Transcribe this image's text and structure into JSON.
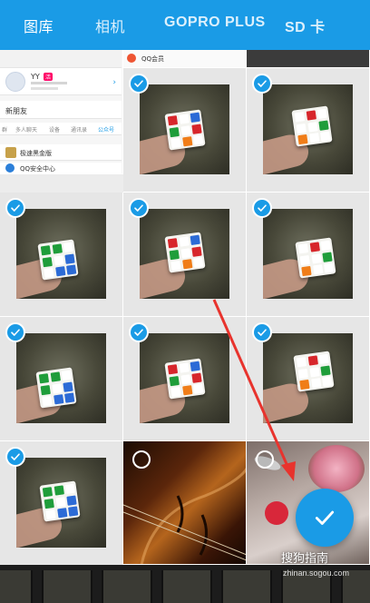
{
  "tabs": [
    {
      "label": "图库",
      "active": true
    },
    {
      "label": "相机",
      "active": false
    },
    {
      "label": "GOPRO PLUS",
      "active": false
    },
    {
      "label": "SD 卡",
      "active": false
    }
  ],
  "screenshot_cell": {
    "name": "YY",
    "badge": "活",
    "add_friend": "新朋友",
    "tabs": [
      "群",
      "多人聊天",
      "设备",
      "通讯录",
      "公众号"
    ],
    "items": [
      "极速黑金版",
      "QQ安全中心",
      "QQ会员"
    ]
  },
  "photos": [
    {
      "selected": true,
      "kind": "rubik"
    },
    {
      "selected": true,
      "kind": "rubik"
    },
    {
      "selected": true,
      "kind": "rubik"
    },
    {
      "selected": true,
      "kind": "rubik"
    },
    {
      "selected": true,
      "kind": "rubik"
    },
    {
      "selected": true,
      "kind": "rubik"
    },
    {
      "selected": true,
      "kind": "rubik"
    },
    {
      "selected": true,
      "kind": "rubik"
    },
    {
      "selected": true,
      "kind": "rubik"
    },
    {
      "selected": false,
      "kind": "violin"
    },
    {
      "selected": false,
      "kind": "dessert"
    }
  ],
  "fab": {
    "icon": "check-icon"
  },
  "watermark": {
    "main": "搜狗指南",
    "sub": "zhinan.sogou.com"
  },
  "colors": {
    "accent": "#1a9be6",
    "annotation_arrow": "#e8332d"
  }
}
